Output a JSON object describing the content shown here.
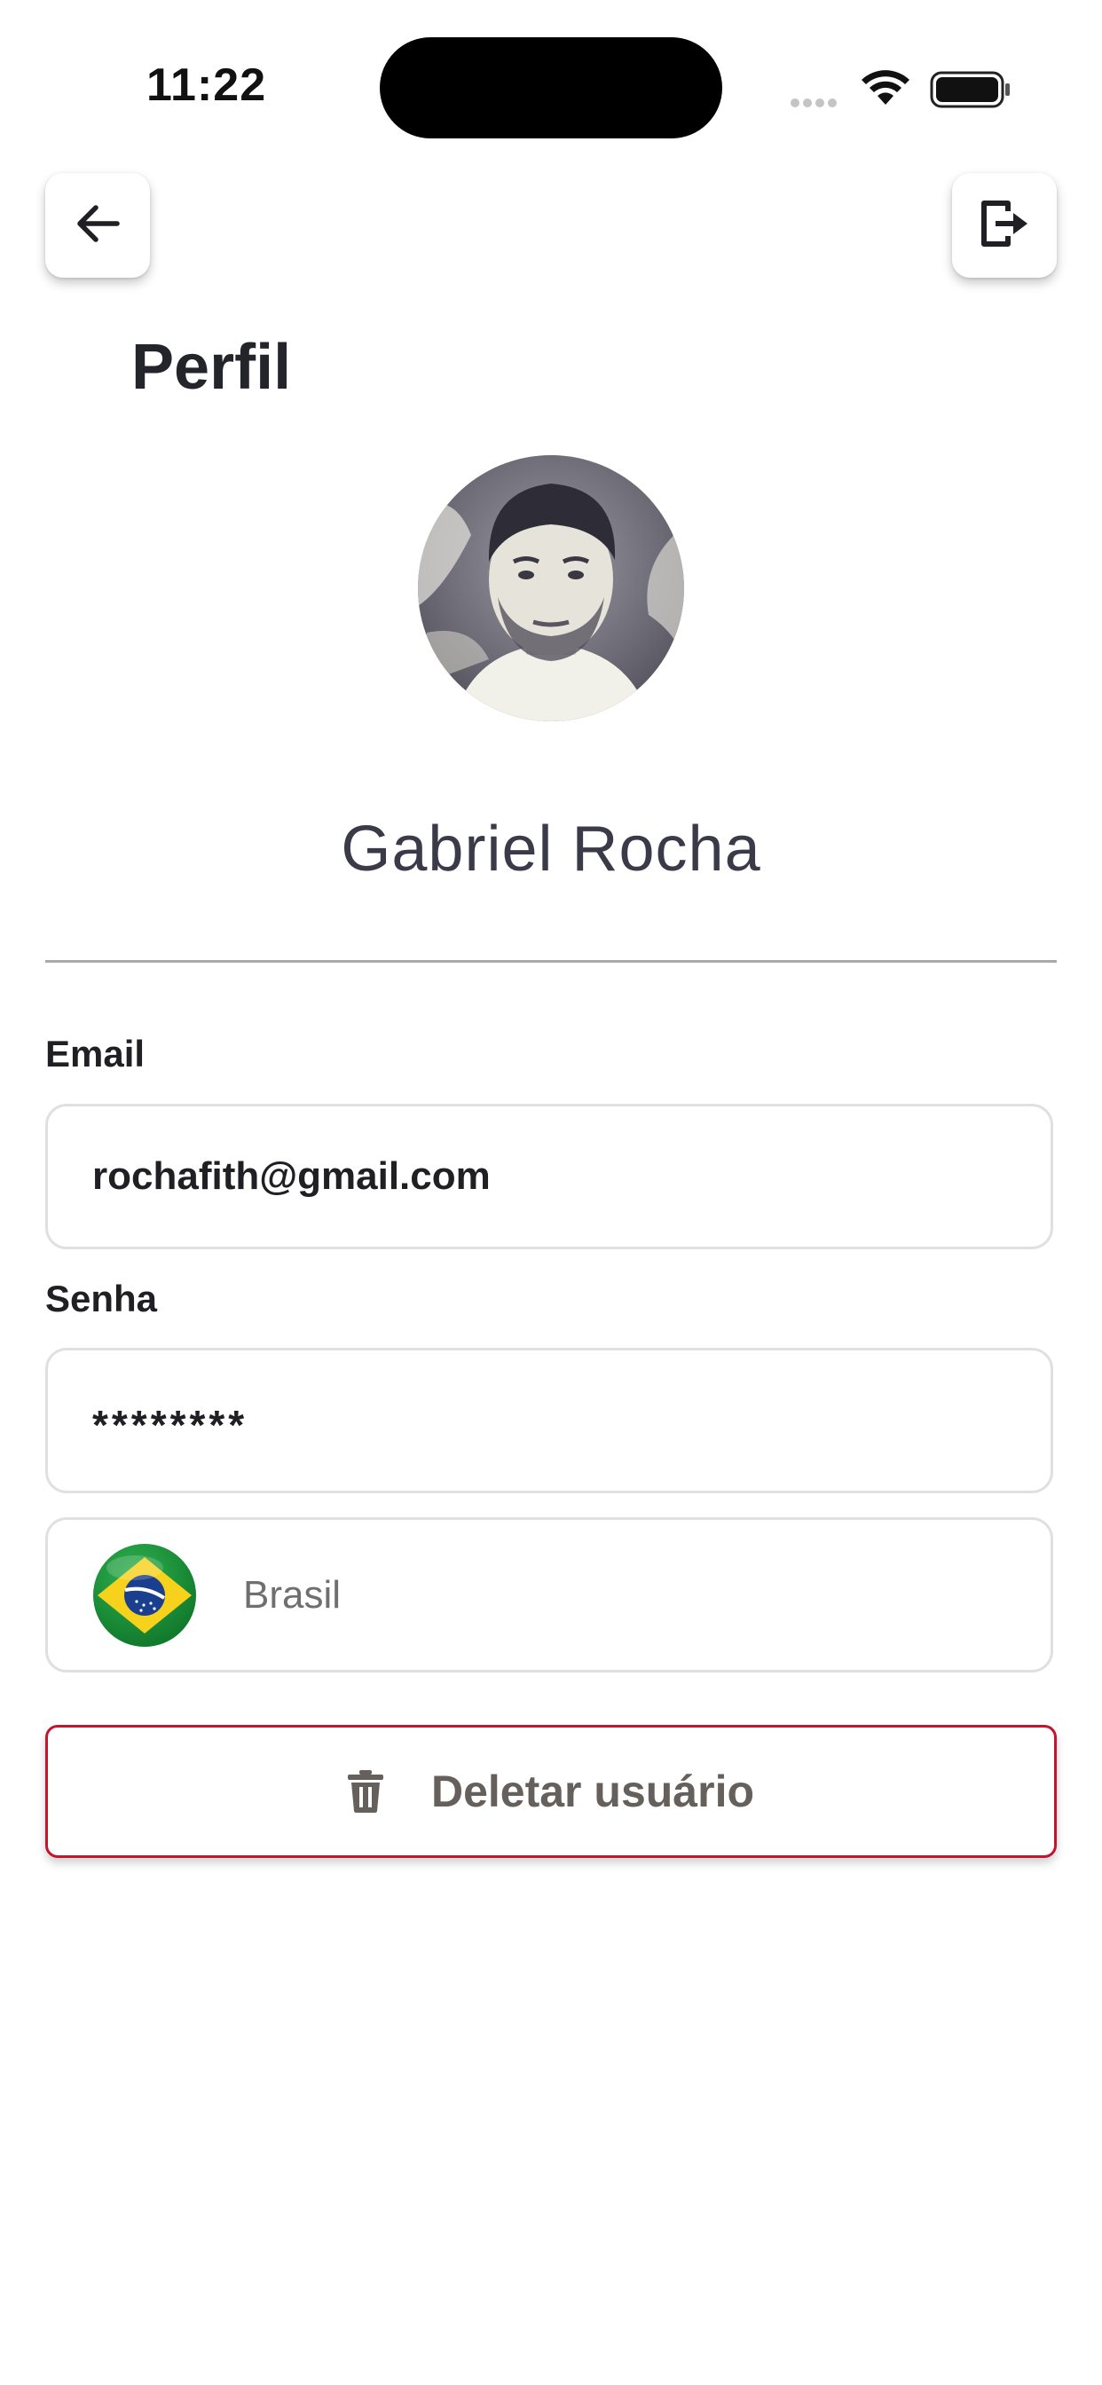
{
  "status_bar": {
    "time": "11:22"
  },
  "header": {
    "back_icon": "arrow-left-icon",
    "logout_icon": "logout-icon",
    "title": "Perfil"
  },
  "profile": {
    "name": "Gabriel Rocha",
    "avatar": "profile-photo"
  },
  "form": {
    "email_label": "Email",
    "email_value": "rochafith@gmail.com",
    "password_label": "Senha",
    "password_value": "********",
    "country_flag_icon": "brazil-flag-icon",
    "country_name": "Brasil"
  },
  "actions": {
    "delete_label": "Deletar usuário",
    "delete_icon": "trash-icon",
    "delete_border_color": "#c4152f"
  }
}
